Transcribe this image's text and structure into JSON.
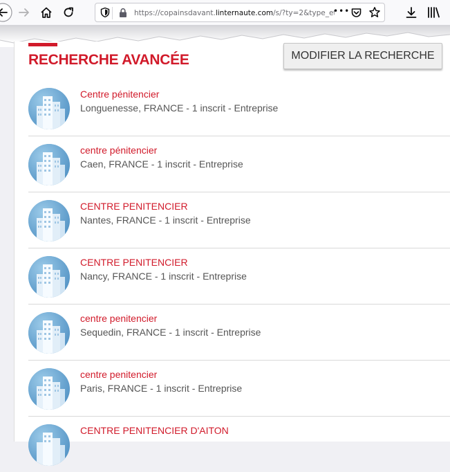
{
  "browser": {
    "url_prefix": "https://copainsdavant.",
    "url_domain": "linternaute.com",
    "url_suffix": "/s/?ty=2&type_etab=",
    "more_glyph": "•••"
  },
  "page": {
    "heading": "RECHERCHE AVANCÉE",
    "modify_button": "MODIFIER LA RECHERCHE",
    "accent_color": "#d11a2a"
  },
  "results": [
    {
      "title": "Centre pénitencier",
      "meta": "Longuenesse, FRANCE - 1 inscrit - Entreprise"
    },
    {
      "title": "centre pénitencier",
      "meta": "Caen, FRANCE - 1 inscrit - Entreprise"
    },
    {
      "title": "CENTRE PENITENCIER",
      "meta": "Nantes, FRANCE - 1 inscrit - Entreprise"
    },
    {
      "title": "CENTRE PENITENCIER",
      "meta": "Nancy, FRANCE - 1 inscrit - Entreprise"
    },
    {
      "title": "centre penitencier",
      "meta": "Sequedin, FRANCE - 1 inscrit - Entreprise"
    },
    {
      "title": "centre penitencier",
      "meta": "Paris, FRANCE - 1 inscrit - Entreprise"
    },
    {
      "title": "CENTRE PENITENCIER D'AITON",
      "meta": ""
    }
  ],
  "icons": {
    "back": "arrow-left-icon",
    "forward": "arrow-right-icon",
    "home": "home-icon",
    "reload": "reload-icon",
    "shield": "tracking-shield-icon",
    "lock": "lock-icon",
    "pocket": "pocket-icon",
    "bookmark": "star-icon",
    "download": "download-icon",
    "library": "library-icon",
    "result": "building-icon"
  }
}
